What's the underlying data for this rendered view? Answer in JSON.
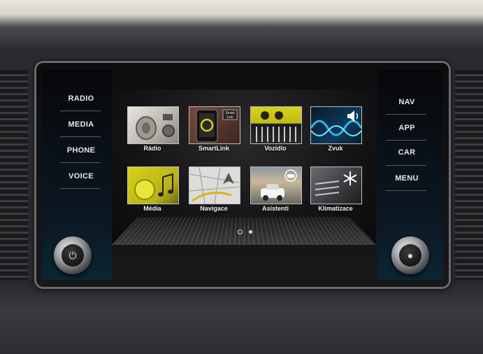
{
  "left_keys": [
    "RADIO",
    "MEDIA",
    "PHONE",
    "VOICE"
  ],
  "right_keys": [
    "NAV",
    "APP",
    "CAR",
    "MENU"
  ],
  "tiles": [
    {
      "label": "Rádio",
      "icon": "radio-speaker-icon"
    },
    {
      "label": "SmartLink",
      "icon": "smartphone-icon"
    },
    {
      "label": "Vozidlo",
      "icon": "car-grille-icon"
    },
    {
      "label": "Zvuk",
      "icon": "sound-wave-icon"
    },
    {
      "label": "Média",
      "icon": "music-note-icon"
    },
    {
      "label": "Navigace",
      "icon": "map-icon"
    },
    {
      "label": "Asistenti",
      "icon": "car-assist-icon"
    },
    {
      "label": "Klimatizace",
      "icon": "snowflake-icon"
    }
  ],
  "pagination": {
    "pages": 2,
    "current": 1
  },
  "colors": {
    "accent_yellow": "#d8d21a",
    "accent_blue": "#1e9be0"
  }
}
